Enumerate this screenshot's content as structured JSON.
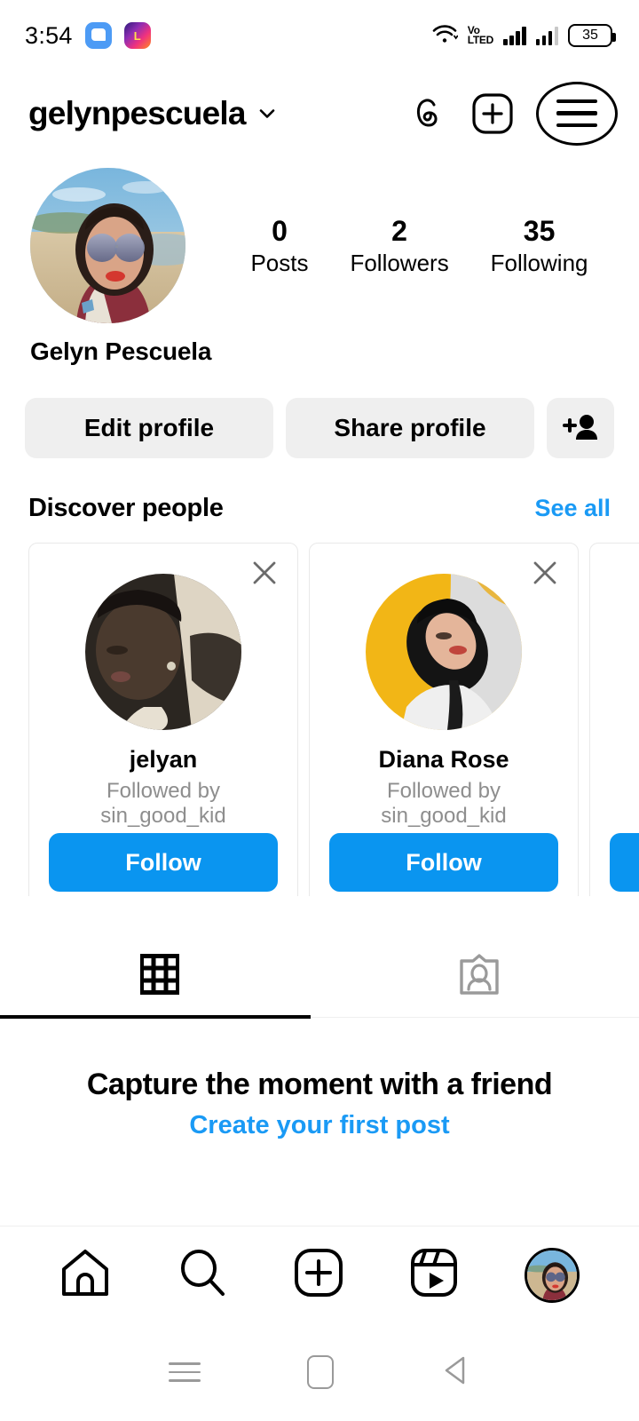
{
  "status_bar": {
    "time": "3:54",
    "app_icons": [
      "messenger-icon",
      "lazada-icon"
    ],
    "wifi": "wifi-icon",
    "network_label_top": "Vo",
    "network_label_bottom": "LTED",
    "battery_level": "35"
  },
  "header": {
    "username": "gelynpescuela",
    "threads_icon": "threads-icon",
    "add_icon": "plus-square-icon",
    "menu_icon": "hamburger-menu-icon"
  },
  "profile": {
    "display_name": "Gelyn Pescuela",
    "avatar": "profile-avatar",
    "stats": [
      {
        "value": "0",
        "label": "Posts"
      },
      {
        "value": "2",
        "label": "Followers"
      },
      {
        "value": "35",
        "label": "Following"
      }
    ]
  },
  "actions": {
    "edit_profile": "Edit profile",
    "share_profile": "Share profile",
    "add_person_icon": "add-person-icon"
  },
  "discover": {
    "title": "Discover people",
    "see_all": "See all",
    "cards": [
      {
        "name": "jelyan",
        "subtitle_line1": "Followed by",
        "subtitle_line2": "sin_good_kid",
        "follow_label": "Follow"
      },
      {
        "name": "Diana Rose",
        "subtitle_line1": "Followed by",
        "subtitle_line2": "sin_good_kid",
        "follow_label": "Follow"
      },
      {
        "name": "",
        "subtitle_line1": "",
        "subtitle_line2": "",
        "follow_label": ""
      }
    ]
  },
  "tabs": {
    "grid_icon": "grid-icon",
    "tagged_icon": "tagged-photos-icon",
    "active": "grid"
  },
  "empty_state": {
    "title": "Capture the moment with a friend",
    "link": "Create your first post"
  },
  "bottom_nav": {
    "items": [
      "home-icon",
      "search-icon",
      "plus-square-icon",
      "reels-icon",
      "profile-avatar"
    ],
    "active": "profile"
  },
  "android_nav": {
    "recents": "recents-icon",
    "home": "home-square-icon",
    "back": "back-triangle-icon"
  },
  "colors": {
    "accent_blue": "#0a95f0",
    "link_blue": "#1a9af5",
    "button_gray": "#efefef",
    "muted_text": "#8e8e8e"
  }
}
